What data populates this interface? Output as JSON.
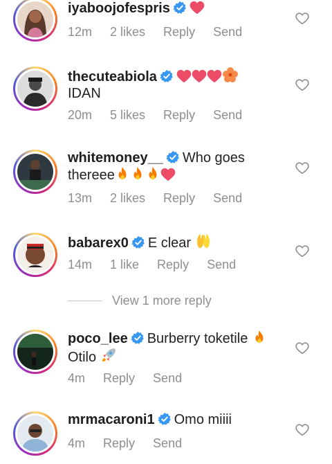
{
  "comments": [
    {
      "username": "iyaboojofespris",
      "text": "",
      "emojis": [
        "heart"
      ],
      "time": "12m",
      "likes": "2 likes",
      "reply": "Reply",
      "send": "Send",
      "avatar_bg": "#7a4a3a"
    },
    {
      "username": "thecuteabiola",
      "text": "",
      "text2": "IDAN",
      "emojis": [
        "heart",
        "heart",
        "heart",
        "hibiscus"
      ],
      "time": "20m",
      "likes": "5 likes",
      "reply": "Reply",
      "send": "Send",
      "avatar_bg": "#6b6b6b"
    },
    {
      "username": "whitemoney__",
      "text": "Who goes",
      "text2": "thereee",
      "emojis": [
        "fire",
        "fire",
        "fire",
        "heart"
      ],
      "time": "13m",
      "likes": "2 likes",
      "reply": "Reply",
      "send": "Send",
      "avatar_bg": "#3a3a3a"
    },
    {
      "username": "babarex0",
      "text": "E clear",
      "emojis": [
        "raised-hands"
      ],
      "time": "14m",
      "likes": "1 like",
      "reply": "Reply",
      "send": "Send",
      "avatar_bg": "#b07a55"
    },
    {
      "username": "poco_lee",
      "text": "Burberry toketile",
      "text2": "Otilo",
      "emojis": [
        "fire"
      ],
      "emojis2": [
        "rocket"
      ],
      "time": "4m",
      "likes": "",
      "reply": "Reply",
      "send": "Send",
      "avatar_bg": "#1f3a2a"
    },
    {
      "username": "mrmacaroni1",
      "text": "Omo miiii",
      "emojis": [],
      "time": "4m",
      "likes": "",
      "reply": "Reply",
      "send": "Send",
      "avatar_bg": "#cfd8e0"
    }
  ],
  "view_more": "View 1 more reply",
  "colors": {
    "verified": "#3897f0",
    "heart": "#ed4c67",
    "fire": "#f57c00",
    "meta": "#8e8e8e"
  }
}
